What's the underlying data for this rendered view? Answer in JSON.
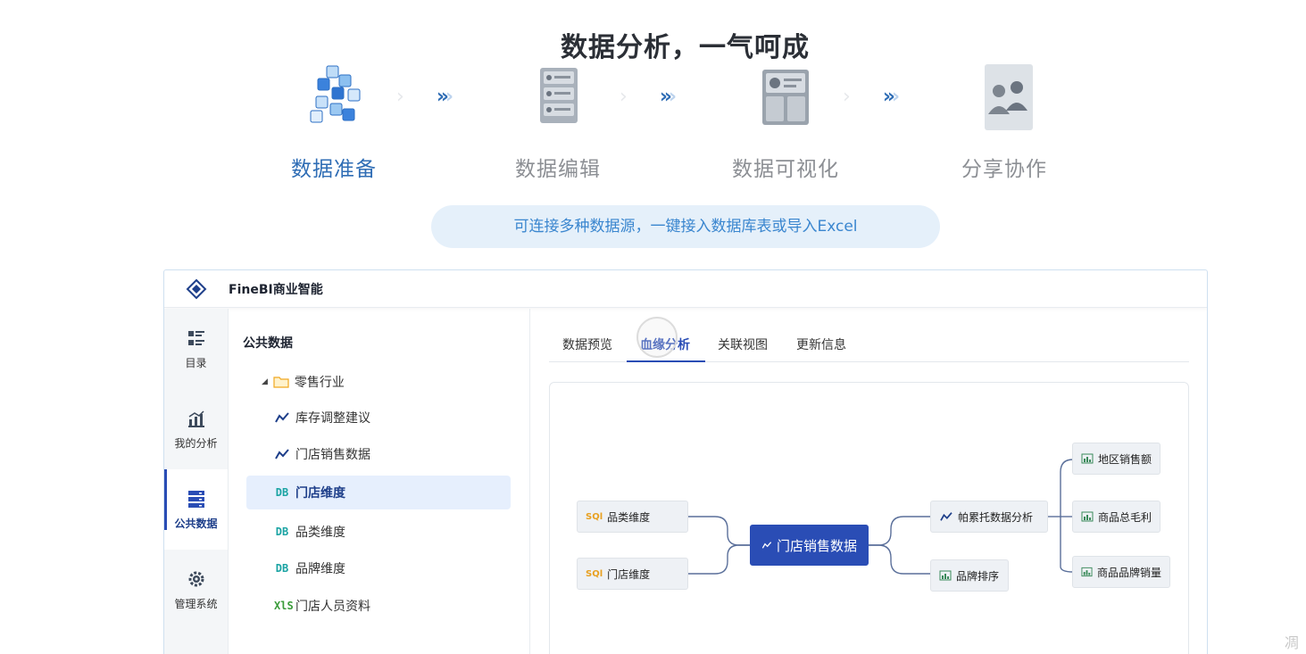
{
  "hero": {
    "title": "数据分析，一气呵成",
    "steps": [
      "数据准备",
      "数据编辑",
      "数据可视化",
      "分享协作"
    ],
    "active_step": 0,
    "subtitle": "可连接多种数据源，一键接入数据库表或导入Excel"
  },
  "app": {
    "title": "FineBI商业智能",
    "rail": [
      {
        "label": "目录",
        "icon": "catalog-icon"
      },
      {
        "label": "我的分析",
        "icon": "chart-icon"
      },
      {
        "label": "公共数据",
        "icon": "database-icon",
        "active": true
      },
      {
        "label": "管理系统",
        "icon": "gear-icon"
      }
    ],
    "tree": {
      "header": "公共数据",
      "folder": "零售行业",
      "items": [
        {
          "label": "库存调整建议",
          "type": "analysis"
        },
        {
          "label": "门店销售数据",
          "type": "analysis"
        },
        {
          "label": "门店维度",
          "type": "db",
          "selected": true
        },
        {
          "label": "品类维度",
          "type": "db"
        },
        {
          "label": "品牌维度",
          "type": "db"
        },
        {
          "label": "门店人员资料",
          "type": "xls"
        }
      ],
      "db_badge": "DB",
      "xls_badge": "XlS"
    },
    "tabs": [
      "数据预览",
      "血缘分析",
      "关联视图",
      "更新信息"
    ],
    "active_tab": 1,
    "lineage": {
      "sql_badge": "SQl",
      "sources": [
        "品类维度",
        "门店维度"
      ],
      "center": "门店销售数据",
      "outputs": [
        "帕累托数据分析",
        "品牌排序"
      ],
      "leaves": [
        "地区销售额",
        "商品总毛利",
        "商品品牌销量"
      ]
    }
  },
  "colors": {
    "accent": "#2a4db5",
    "step_active": "#2f6db5",
    "pill_bg": "#e5f0fa",
    "pill_text": "#3a86cf"
  },
  "watermark": "凋"
}
